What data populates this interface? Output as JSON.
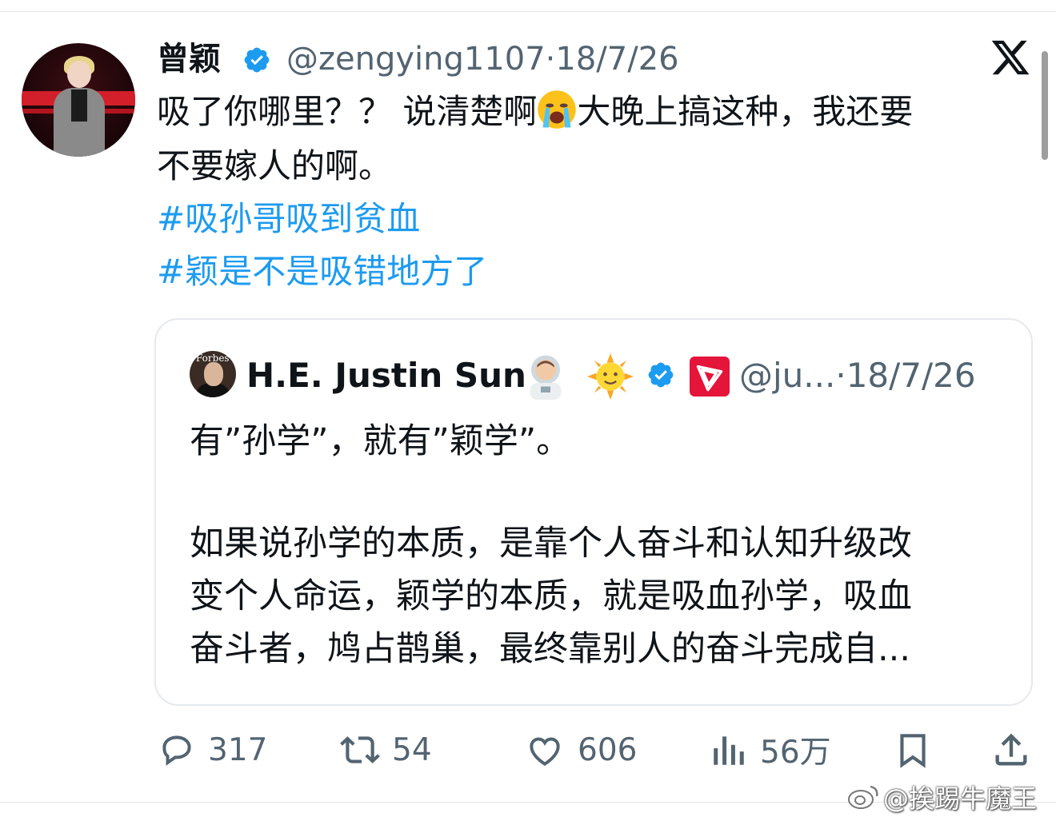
{
  "tweet": {
    "author_name": "曾颖",
    "author_handle": "@zengying1107",
    "date_sep": "·",
    "date": "18/7/26",
    "text_line1_a": "吸了你哪里？？ 说清楚啊",
    "text_line1_b": "大晚上搞这种，我还要",
    "text_line2": "不要嫁人的啊。",
    "hashtag1": "#吸孙哥吸到贫血",
    "hashtag2": "#颖是不是吸错地方了",
    "icons": {
      "verified": "verified-badge-icon",
      "logo": "x-logo-icon",
      "emoji": "loudly-crying-face-emoji"
    }
  },
  "quoted": {
    "avatar_label": "Forbes",
    "author_name": "H.E. Justin Sun",
    "author_handle": "@ju...",
    "date_sep": "·",
    "date": "18/7/26",
    "line1": "有”孙学”，就有”颖学”。",
    "line2": "如果说孙学的本质，是靠个人奋斗和认知升级改",
    "line3": "变个人命运，颖学的本质，就是吸血孙学，吸血",
    "line4": "奋斗者，鸠占鹊巢，最终靠别人的奋斗完成自...",
    "icons": [
      "astronaut-emoji",
      "sun-with-face-emoji",
      "verified-badge-icon",
      "tron-logo-icon"
    ]
  },
  "actions": {
    "replies": "317",
    "retweets": "54",
    "likes": "606",
    "views": "56万"
  },
  "watermark": "@挨踢牛魔王",
  "colors": {
    "link": "#1d9bf0",
    "muted": "#536471",
    "verified": "#1d9bf0",
    "tron": "#e5143a"
  }
}
